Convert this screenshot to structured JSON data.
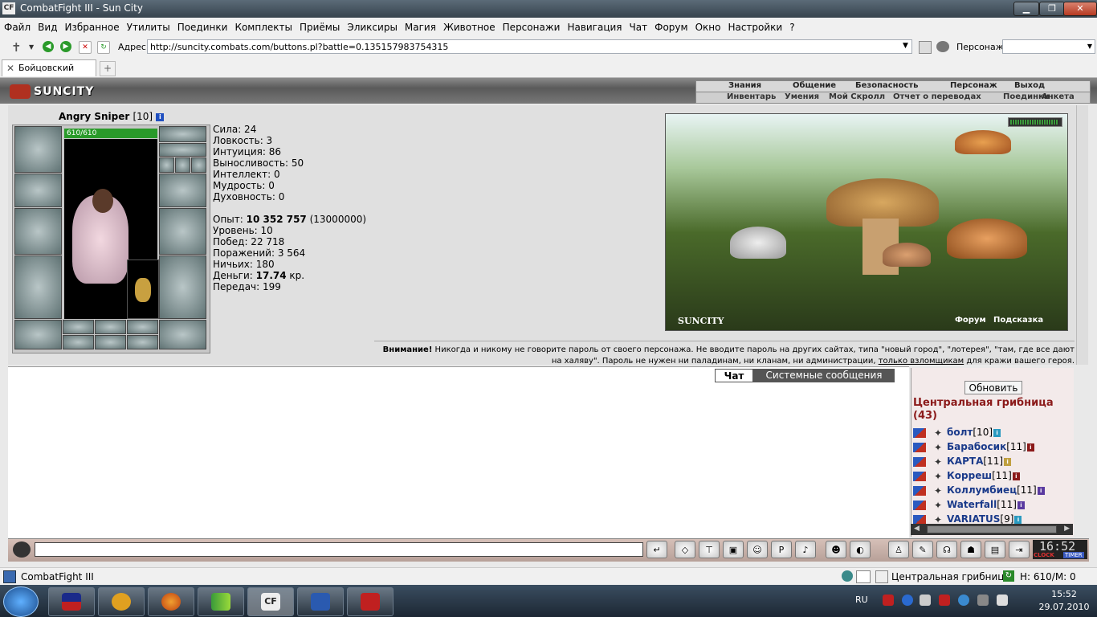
{
  "window": {
    "title": "CombatFight III - Sun City",
    "logo": "CF"
  },
  "menu": [
    "Файл",
    "Вид",
    "Избранное",
    "Утилиты",
    "Поединки",
    "Комплекты",
    "Приёмы",
    "Эликсиры",
    "Магия",
    "Животное",
    "Персонажи",
    "Навигация",
    "Чат",
    "Форум",
    "Окно",
    "Настройки",
    "?"
  ],
  "address": {
    "label": "Адрес:",
    "url": "http://suncity.combats.com/buttons.pl?battle=0.135157983754315",
    "char_label": "Персонаж:"
  },
  "tab": {
    "title": "Бойцовский клуб"
  },
  "game": {
    "logo": "SUNCITY",
    "topnav": [
      "Знания",
      "Общение",
      "Безопасность",
      "Персонаж",
      "Выход"
    ],
    "subnav": [
      "Инвентарь",
      "Умения",
      "Мой Скролл",
      "Отчет о переводах",
      "Поединки",
      "Анкета"
    ]
  },
  "character": {
    "name": "Angry Sniper",
    "level": "[10]",
    "hp": "610/610",
    "hp_fraction": 1.0
  },
  "stats": {
    "sila": "Сила: 24",
    "lovkost": "Ловкость: 3",
    "intuicia": "Интуиция: 86",
    "vynoslivost": "Выносливость: 50",
    "intellekt": "Интеллект: 0",
    "mudrost": "Мудрость: 0",
    "duhovnost": "Духовность: 0",
    "opyt_label": "Опыт: ",
    "opyt_value": "10 352 757",
    "opyt_next": " (13000000)",
    "uroven": "Уровень: 10",
    "pobed": "Побед: 22 718",
    "porazheniy": "Поражений: 3 564",
    "nichih": "Ничьих: 180",
    "dengi_label": "Деньги: ",
    "dengi_value": "17.74",
    "dengi_unit": " кр.",
    "peredach": "Передач: 199"
  },
  "location": {
    "label": "SUNCITY",
    "forum": "Форум",
    "hint": "Подсказка"
  },
  "warning": {
    "bold": "Внимание!",
    "text1": " Никогда и никому не говорите пароль от своего персонажа. Не вводите пароль на других сайтах, типа \"новый город\", \"лотерея\", \"там, где все дают на халяву\". Пароль не нужен ни паладинам, ни кланам, ни администрации, ",
    "link": "только взломщикам",
    "text2": " для кражи вашего героя."
  },
  "chat": {
    "tab_chat": "Чат",
    "tab_system": "Системные сообщения"
  },
  "online": {
    "refresh": "Обновить",
    "room": "Центральная грибница (43)",
    "users": [
      {
        "name": "болт",
        "level": "[10]",
        "info_color": "#2a9ac0"
      },
      {
        "name": "Барабосик",
        "level": "[11]",
        "info_color": "#8b1a1a"
      },
      {
        "name": "КАРТА",
        "level": "[11]",
        "info_color": "#c0a040"
      },
      {
        "name": "Корреш",
        "level": "[11]",
        "info_color": "#8b1a1a"
      },
      {
        "name": "Коллумбиец",
        "level": "[11]",
        "info_color": "#5a3aa0"
      },
      {
        "name": "Waterfall",
        "level": "[11]",
        "info_color": "#5a3aa0"
      },
      {
        "name": "VARIATUS",
        "level": "[9]",
        "info_color": "#2a9ac0"
      }
    ]
  },
  "clock": {
    "time": "16:52",
    "clock_label": "CLOCK",
    "timer_label": "TIMER"
  },
  "statusbar": {
    "app": "CombatFight III",
    "location": "Центральная грибница",
    "hp": "Н: 610/М: 0"
  },
  "taskbar": {
    "lang": "RU",
    "time": "15:52",
    "date": "29.07.2010"
  },
  "colors": {
    "hp_green": "#2a9a2a",
    "room_red": "#8b1a1a",
    "user_blue": "#1a3a8a"
  }
}
